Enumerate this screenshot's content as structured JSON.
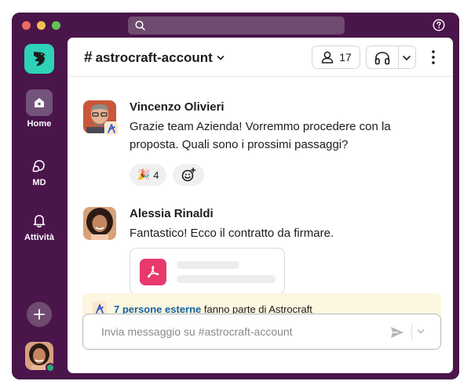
{
  "app": {
    "search": {
      "placeholder": ""
    }
  },
  "sidebar": {
    "items": [
      {
        "label": "Home",
        "icon": "home-icon",
        "active": true
      },
      {
        "label": "MD",
        "icon": "direct-messages-icon",
        "active": false
      },
      {
        "label": "Attività",
        "icon": "bell-icon",
        "active": false
      }
    ],
    "add_icon": "plus-icon"
  },
  "channel": {
    "name": "astrocraft-account",
    "member_count": "17"
  },
  "messages": [
    {
      "author": "Vincenzo Olivieri",
      "text": "Grazie team Azienda! Vorremmo procedere con la proposta. Quali sono i prossimi passaggi?",
      "reactions": [
        {
          "emoji": "🎉",
          "count": "4"
        }
      ]
    },
    {
      "author": "Alessia Rinaldi",
      "text": "Fantastico! Ecco il contratto da firmare.",
      "attachment": {
        "type": "pdf-icon"
      }
    }
  ],
  "external_banner": {
    "link_text": "7 persone esterne",
    "rest_text": " fanno parte di Astrocraft"
  },
  "composer": {
    "placeholder": "Invia messaggio su #astrocraft-account"
  },
  "colors": {
    "aubergine": "#4a154b",
    "logo": "#2ed3b7",
    "pdf": "#e8396c",
    "link": "#1264a3",
    "banner": "#fdf6e0",
    "presence": "#2bac76"
  }
}
